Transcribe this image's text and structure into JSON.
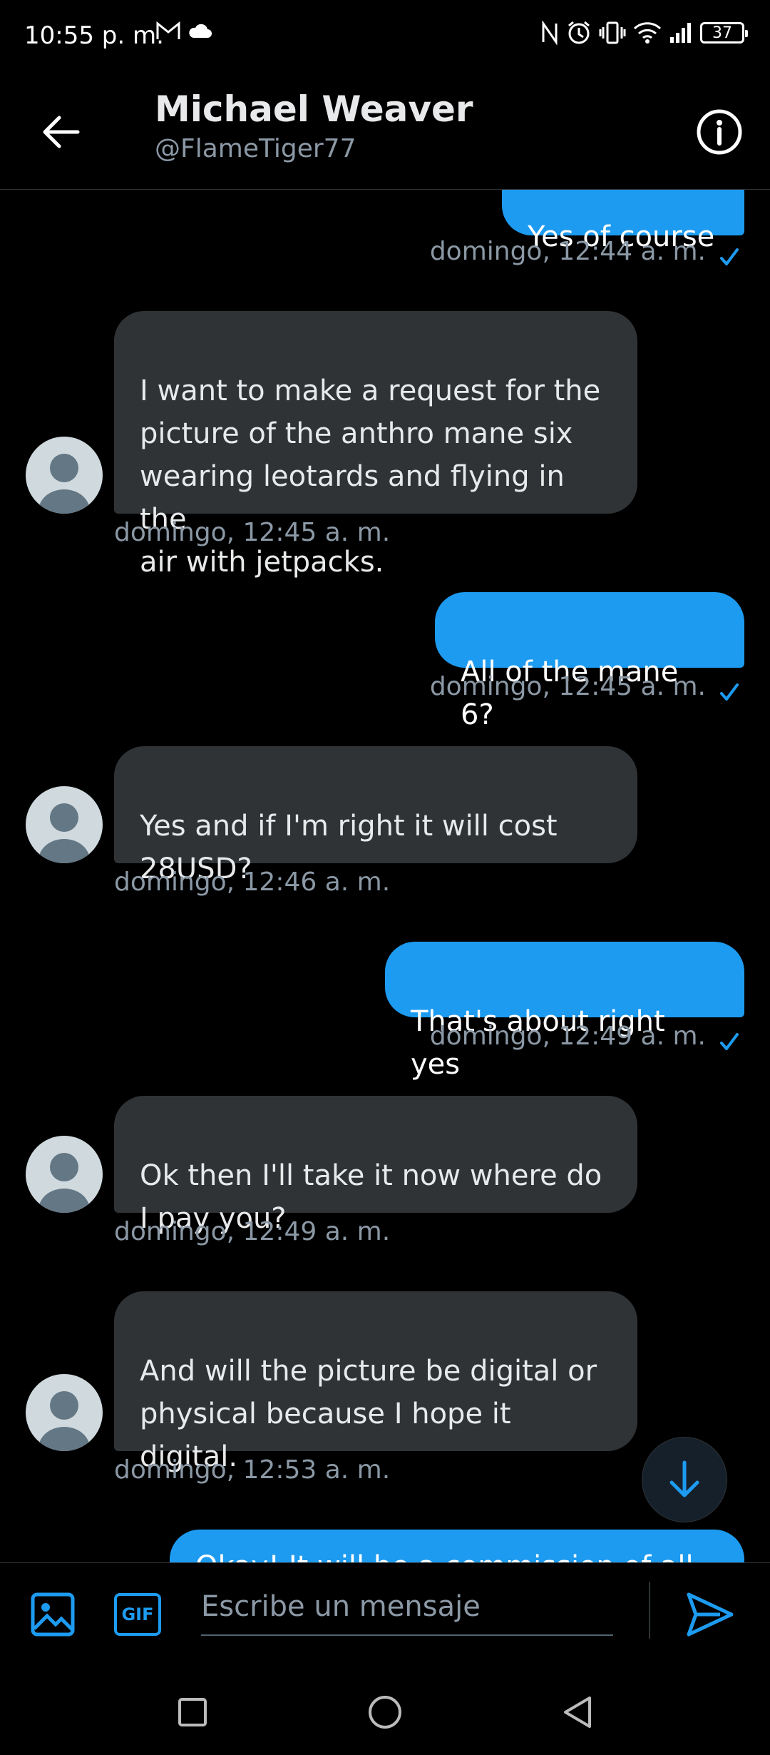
{
  "status_bar": {
    "time": "10:55 p. m.",
    "battery": "37",
    "left_icons": [
      "gmail-icon",
      "cloud-icon"
    ],
    "right_icons": [
      "nfc-icon",
      "alarm-icon",
      "vibrate-icon",
      "wifi-icon",
      "signal-icon"
    ]
  },
  "header": {
    "name": "Michael Weaver",
    "handle": "@FlameTiger77"
  },
  "colors": {
    "accent": "#1d9bf0",
    "received_bubble": "#2f3336",
    "muted_text": "#8b98a5",
    "background": "#000000"
  },
  "messages": [
    {
      "direction": "sent",
      "text": "Yes of course",
      "time": "domingo, 12:44 a. m.",
      "read": true
    },
    {
      "direction": "received",
      "text": "I want to make a request for the\npicture of the anthro mane six\nwearing leotards and flying in the\nair with jetpacks.",
      "time": "domingo, 12:45 a. m."
    },
    {
      "direction": "sent",
      "text": "All of the mane 6?",
      "time": "domingo, 12:45 a. m.",
      "read": true
    },
    {
      "direction": "received",
      "text": "Yes and if I'm right it will cost\n28USD?",
      "time": "domingo, 12:46 a. m."
    },
    {
      "direction": "sent",
      "text": "That's about right yes",
      "time": "domingo, 12:49 a. m.",
      "read": true
    },
    {
      "direction": "received",
      "text": "Ok then I'll take it now where do\nI pay you?",
      "time": "domingo, 12:49 a. m."
    },
    {
      "direction": "received",
      "text": "And will the picture be digital or\nphysical because I hope it\ndigital.",
      "time": "domingo, 12:53 a. m."
    },
    {
      "direction": "sent",
      "text": "Okay! It will be a commission of all",
      "time": ""
    }
  ],
  "composer": {
    "placeholder": "Escribe un mensaje",
    "gif_label": "GIF"
  }
}
